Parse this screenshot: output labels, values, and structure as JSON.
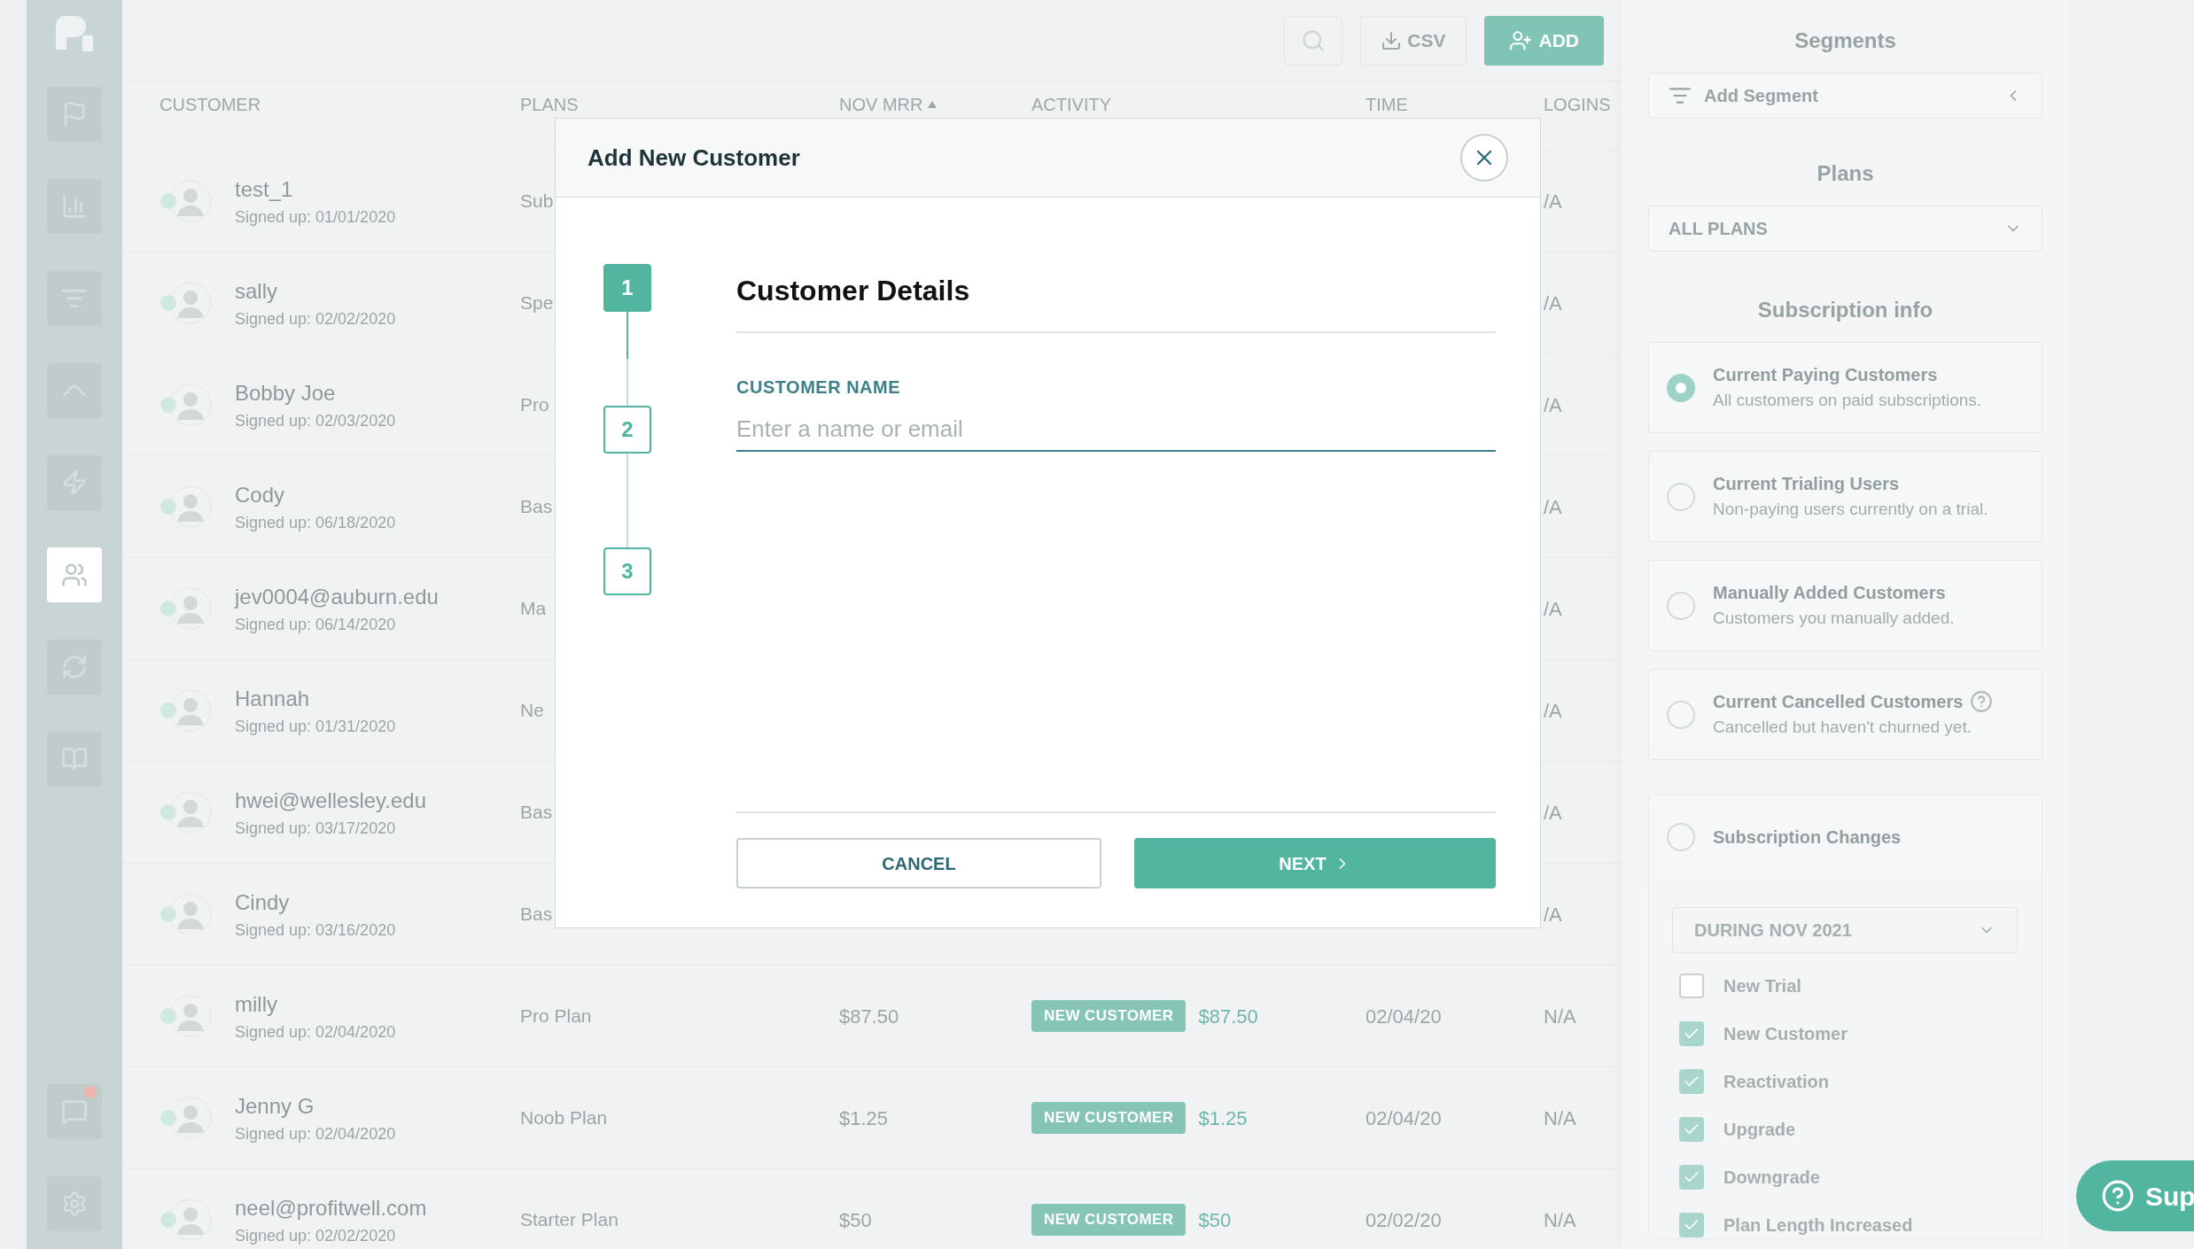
{
  "sidebar": {
    "items": [
      {
        "kind": "flag",
        "selected": false,
        "unread": false
      },
      {
        "kind": "chart",
        "selected": false,
        "unread": false
      },
      {
        "kind": "filter",
        "selected": false,
        "unread": false
      },
      {
        "kind": "curve",
        "selected": false,
        "unread": false
      },
      {
        "kind": "bolt",
        "selected": false,
        "unread": false
      },
      {
        "kind": "people",
        "selected": true,
        "unread": false
      },
      {
        "kind": "refresh",
        "selected": false,
        "unread": false
      },
      {
        "kind": "book",
        "selected": false,
        "unread": false
      }
    ],
    "bottom": [
      {
        "kind": "chat",
        "selected": false,
        "unread": true
      },
      {
        "kind": "settings",
        "selected": false,
        "unread": false
      }
    ]
  },
  "toolbar": [
    {
      "kind": "search"
    },
    {
      "kind": "download",
      "label": "CSV"
    },
    {
      "kind": "add",
      "label": "ADD"
    }
  ],
  "table": {
    "columns": [
      {
        "label": "CUSTOMER"
      },
      {
        "label": "PLANS"
      },
      {
        "label": "NOV MRR",
        "sorted": true
      },
      {
        "label": "ACTIVITY"
      },
      {
        "label": "TIME"
      },
      {
        "label": "LOGINS"
      }
    ],
    "rows": [
      {
        "name": "test_1",
        "signed_up": "Signed up: 01/01/2020",
        "plan": "Sub",
        "logins": "/A"
      },
      {
        "name": "sally",
        "signed_up": "Signed up: 02/02/2020",
        "plan": "Spe",
        "logins": "/A"
      },
      {
        "name": "Bobby Joe",
        "signed_up": "Signed up: 02/03/2020",
        "plan": "Pro",
        "logins": "/A"
      },
      {
        "name": "Cody",
        "signed_up": "Signed up: 06/18/2020",
        "plan": "Bas",
        "logins": "/A"
      },
      {
        "name": "jev0004@auburn.edu",
        "signed_up": "Signed up: 06/14/2020",
        "plan": "Ma",
        "logins": "/A"
      },
      {
        "name": "Hannah",
        "signed_up": "Signed up: 01/31/2020",
        "plan": "Ne",
        "logins": "/A"
      },
      {
        "name": "hwei@wellesley.edu",
        "signed_up": "Signed up: 03/17/2020",
        "plan": "Bas",
        "logins": "/A"
      },
      {
        "name": "Cindy",
        "signed_up": "Signed up: 03/16/2020",
        "plan": "Bas",
        "logins": "/A"
      },
      {
        "name": "milly",
        "signed_up": "Signed up: 02/04/2020",
        "plan": "Pro Plan",
        "mrr": "$87.50",
        "badge": "NEW CUSTOMER",
        "amount": "$87.50",
        "time": "02/04/20",
        "logins": "N/A"
      },
      {
        "name": "Jenny G",
        "signed_up": "Signed up: 02/04/2020",
        "plan": "Noob Plan",
        "mrr": "$1.25",
        "badge": "NEW CUSTOMER",
        "amount": "$1.25",
        "time": "02/04/20",
        "logins": "N/A"
      },
      {
        "name": "neel@profitwell.com",
        "signed_up": "Signed up: 02/02/2020",
        "plan": "Starter Plan",
        "mrr": "$50",
        "badge": "NEW CUSTOMER",
        "amount": "$50",
        "time": "02/02/20",
        "logins": "N/A"
      }
    ]
  },
  "modal": {
    "title": "Add New Customer",
    "steps": [
      {
        "label": "1",
        "selected": true
      },
      {
        "label": "2",
        "selected": false
      },
      {
        "label": "3",
        "selected": false
      }
    ],
    "heading": "Customer Details",
    "field": {
      "label": "CUSTOMER NAME",
      "placeholder": "Enter a name or email"
    },
    "buttons": [
      {
        "kind": "secondary",
        "label": "CANCEL"
      },
      {
        "kind": "primary",
        "label": "NEXT"
      }
    ]
  },
  "panel": {
    "segments_title": "Segments",
    "add_segment": "Add Segment",
    "plans_title": "Plans",
    "plans_value": "ALL PLANS",
    "subscription_title": "Subscription info",
    "options": [
      {
        "title": "Current Paying Customers",
        "desc": "All customers on paid subscriptions.",
        "selected": true,
        "help": false
      },
      {
        "title": "Current Trialing Users",
        "desc": "Non-paying users currently on a trial.",
        "selected": false,
        "help": false
      },
      {
        "title": "Manually Added Customers",
        "desc": "Customers you manually added.",
        "selected": false,
        "help": false
      },
      {
        "title": "Current Cancelled Customers",
        "desc": "Cancelled but haven't churned yet.",
        "selected": false,
        "help": true
      }
    ],
    "changes": {
      "title": "Subscription Changes",
      "selected": false,
      "period": "DURING NOV 2021",
      "items": [
        {
          "label": "New Trial",
          "checked": false
        },
        {
          "label": "New Customer",
          "checked": true
        },
        {
          "label": "Reactivation",
          "checked": true
        },
        {
          "label": "Upgrade",
          "checked": true
        },
        {
          "label": "Downgrade",
          "checked": true
        },
        {
          "label": "Plan Length Increased",
          "checked": true
        }
      ]
    }
  },
  "support": {
    "label": "Sup"
  }
}
